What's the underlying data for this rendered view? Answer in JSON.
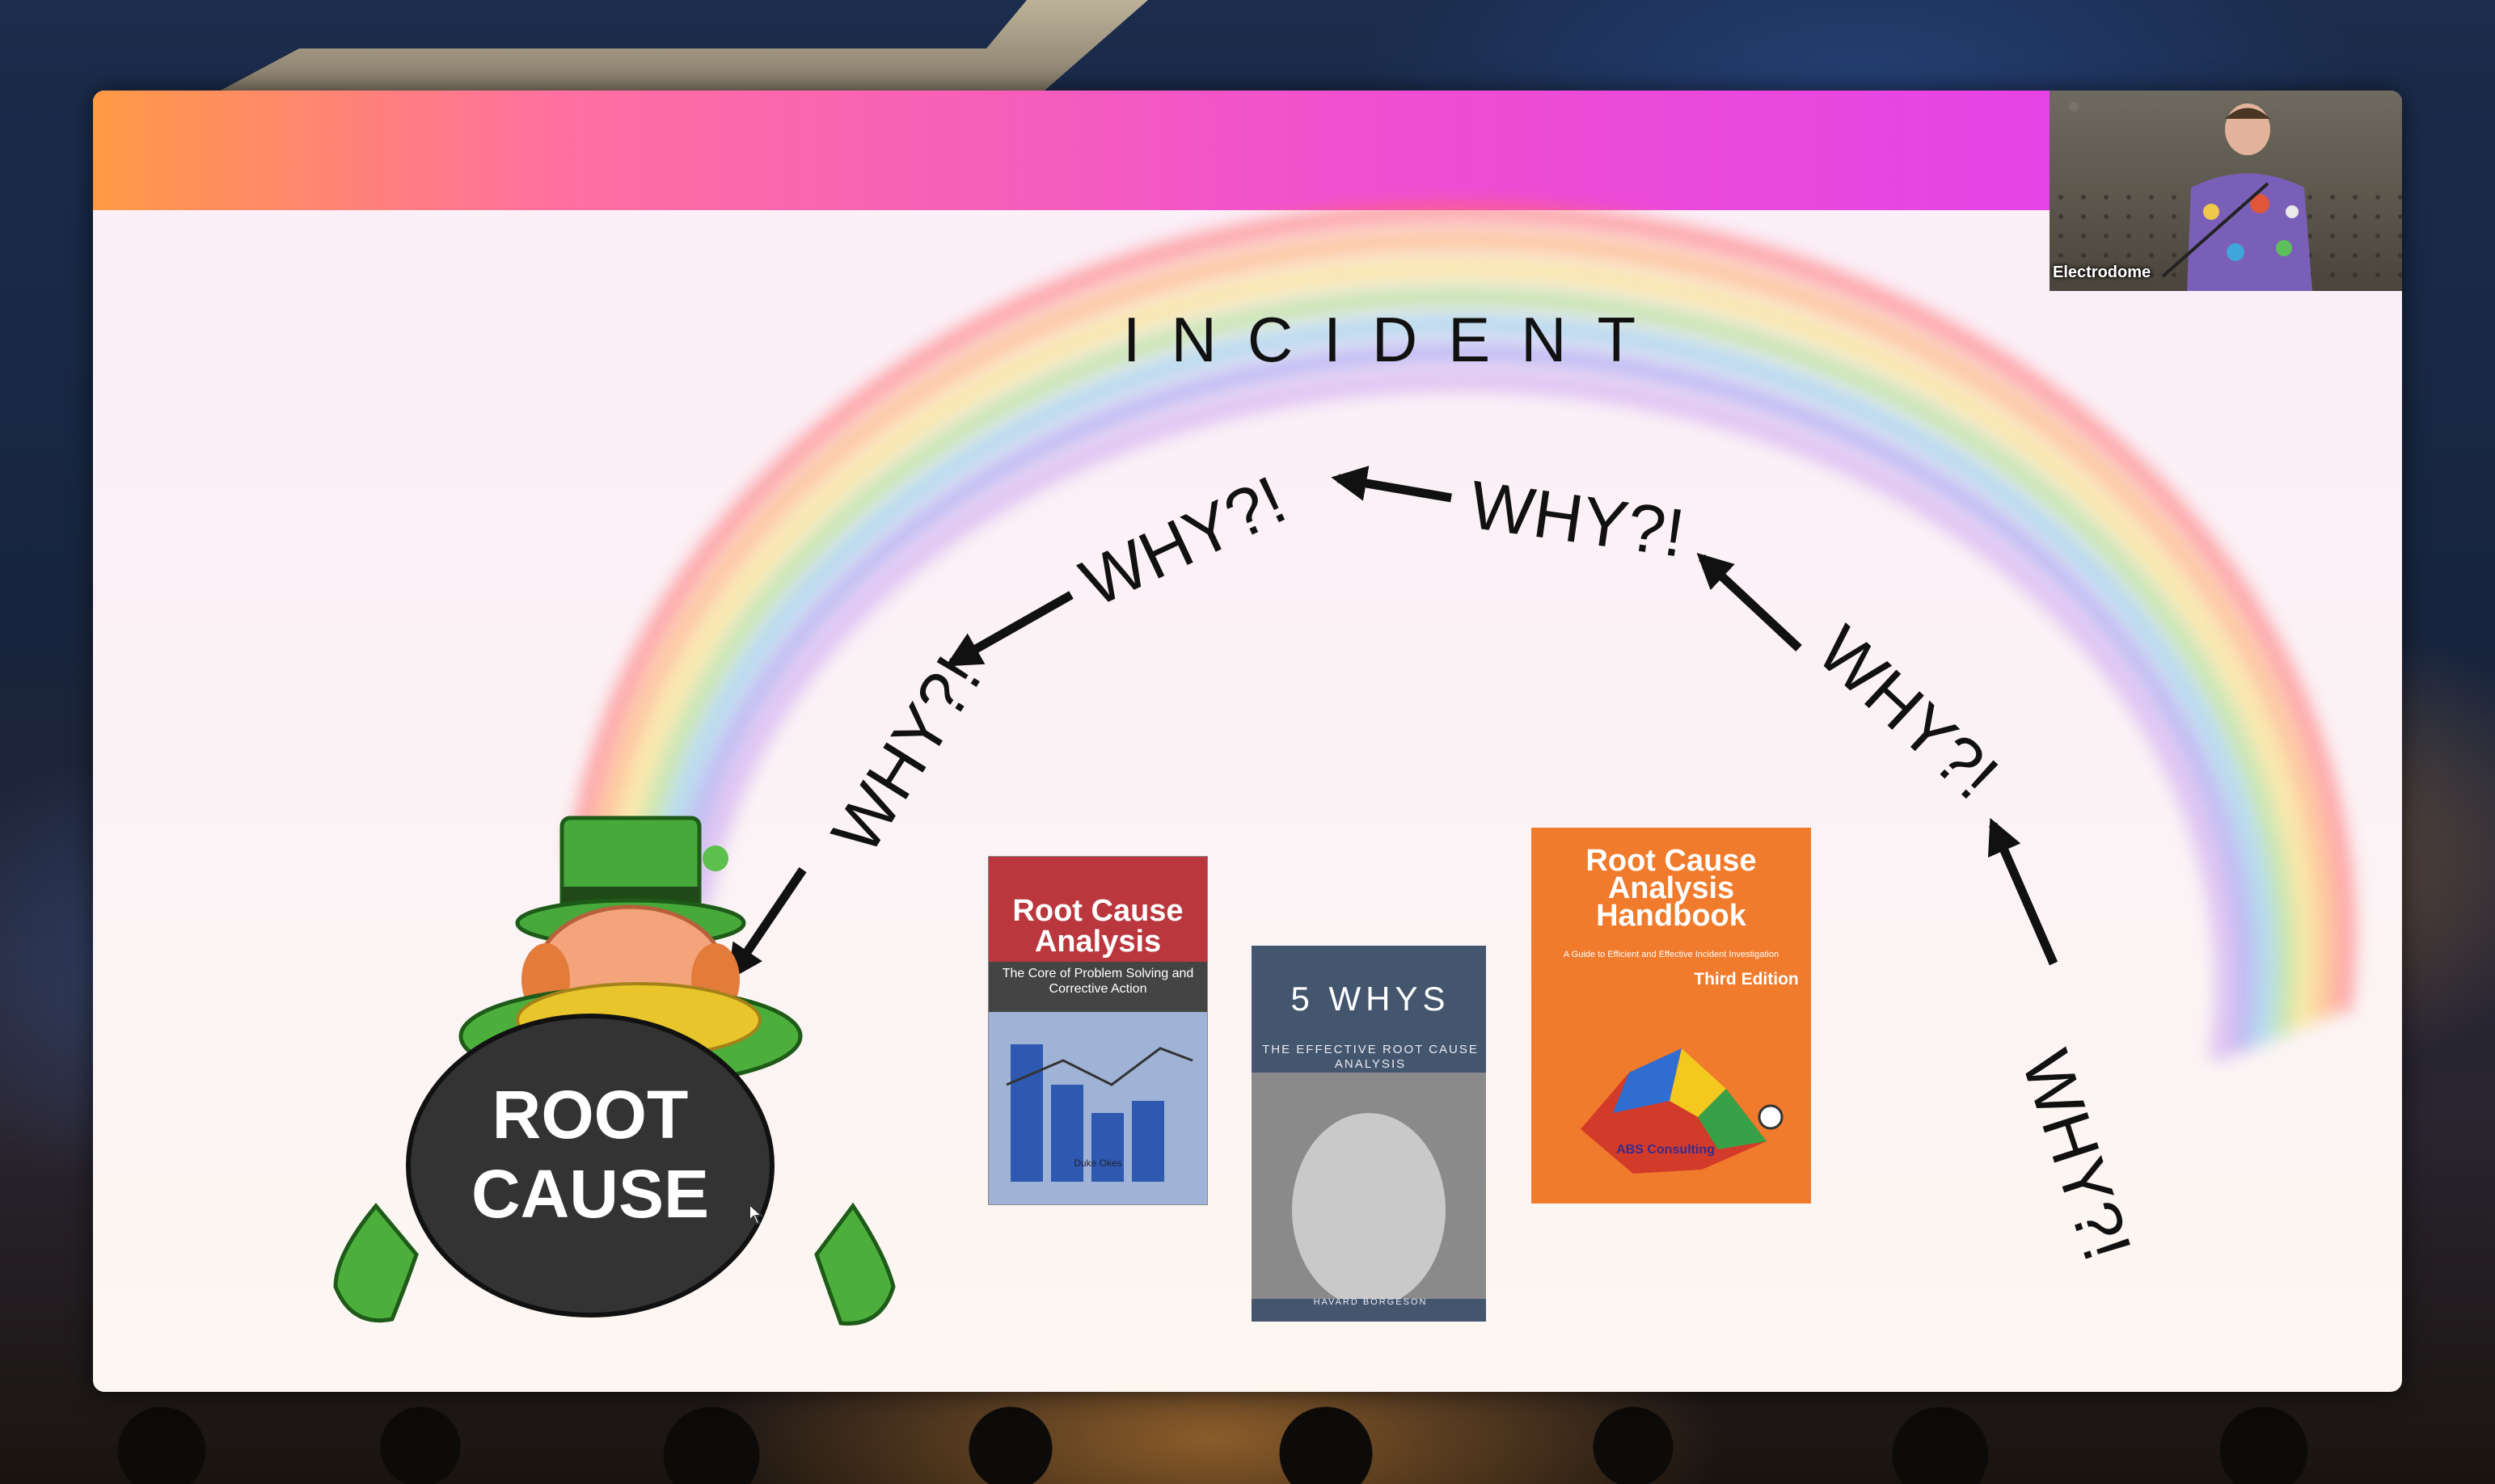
{
  "slide": {
    "headline": "INCIDENT",
    "arrow_label": "WHY?!",
    "pot_label_line1": "ROOT",
    "pot_label_line2": "CAUSE"
  },
  "books": [
    {
      "title": "Root Cause Analysis",
      "subtitle": "The Core of Problem Solving and Corrective Action",
      "author": "Duke Okes",
      "color": "#b9373d"
    },
    {
      "title": "5 WHYS",
      "subtitle": "THE EFFECTIVE ROOT CAUSE ANALYSIS",
      "author": "HAVARD BORGESON",
      "color": "#44556e"
    },
    {
      "title": "Root Cause Analysis Handbook",
      "subtitle": "A Guide to Efficient and Effective Incident Investigation",
      "edition": "Third Edition",
      "publisher": "ABS Consulting",
      "color": "#f07b2c"
    }
  ],
  "webcam": {
    "label": "Electrodome"
  },
  "colors": {
    "banner_start": "#ff9a45",
    "banner_end": "#e03cf0",
    "slide_bg": "#fbf1f5"
  }
}
